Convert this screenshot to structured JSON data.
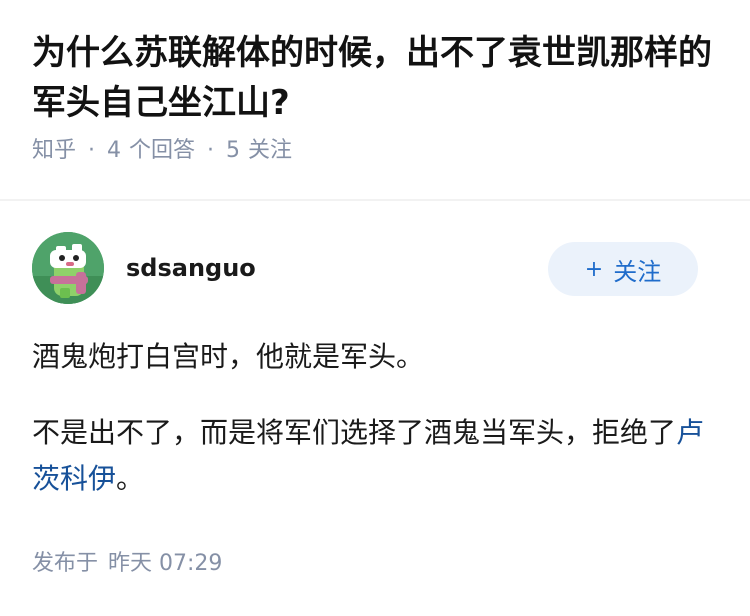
{
  "question": {
    "title": "为什么苏联解体的时候，出不了袁世凯那样的军头自己坐江山?",
    "source": "知乎",
    "answers_count": "4",
    "answers_label": "个回答",
    "followers_count": "5",
    "followers_label": "关注"
  },
  "author": {
    "name": "sdsanguo",
    "avatar_icon": "cartoon-avatar-icon",
    "follow_plus": "+",
    "follow_label": "关注"
  },
  "answer": {
    "paragraph1": "酒鬼炮打白宫时，他就是军头。",
    "paragraph2_text": "不是出不了，而是将军们选择了酒鬼当军头，拒绝了",
    "paragraph2_link": "卢茨科伊",
    "paragraph2_end": "。"
  },
  "footer": {
    "published_label": "发布于",
    "published_time": "昨天 07:29"
  },
  "colors": {
    "meta_gray": "#8590a6",
    "link_blue": "#175199",
    "follow_blue": "#1f6ccb",
    "follow_bg": "#ebf2fb"
  }
}
